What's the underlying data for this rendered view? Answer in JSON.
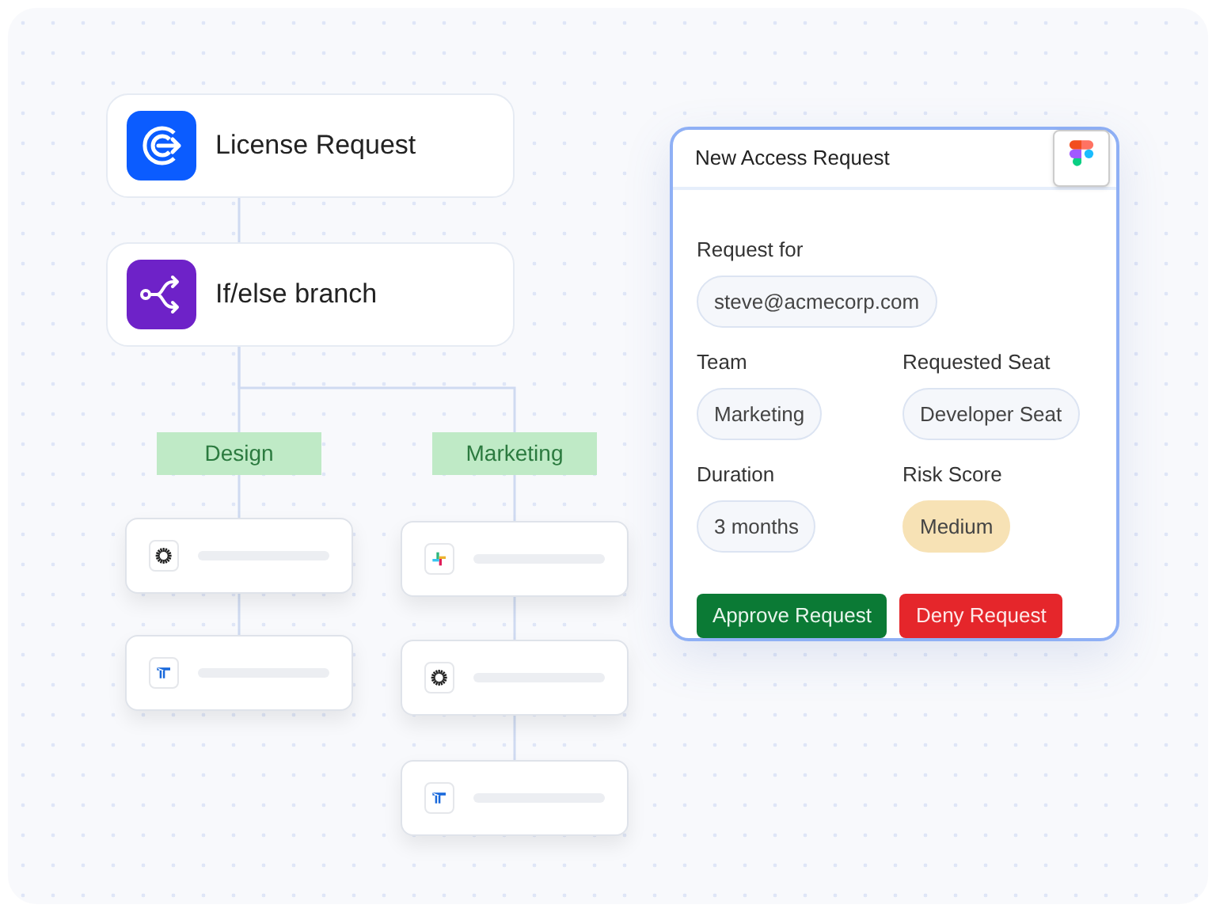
{
  "nodes": [
    {
      "title": "License Request",
      "kind": "license"
    },
    {
      "title": "If/else branch",
      "kind": "branch"
    }
  ],
  "branches": [
    {
      "label": "Design",
      "steps": [
        {
          "kind": "sunburst"
        },
        {
          "kind": "columns"
        }
      ]
    },
    {
      "label": "Marketing",
      "steps": [
        {
          "kind": "hash"
        },
        {
          "kind": "sunburst"
        },
        {
          "kind": "columns"
        }
      ]
    }
  ],
  "form": {
    "title": "New Access Request",
    "fields": [
      {
        "label": "Request for",
        "value": "steve@acmecorp.com",
        "kind": "plain"
      },
      {
        "label": "Team",
        "value": "Marketing",
        "kind": "plain"
      },
      {
        "label": "Requested Seat",
        "value": "Developer Seat",
        "kind": "plain"
      },
      {
        "label": "Duration",
        "value": "3 months",
        "kind": "plain"
      },
      {
        "label": "Risk Score",
        "value": "Medium",
        "kind": "warning"
      }
    ],
    "buttons": [
      {
        "label": "Approve Request",
        "kind": "approve"
      },
      {
        "label": "Deny Request",
        "kind": "deny"
      }
    ]
  }
}
